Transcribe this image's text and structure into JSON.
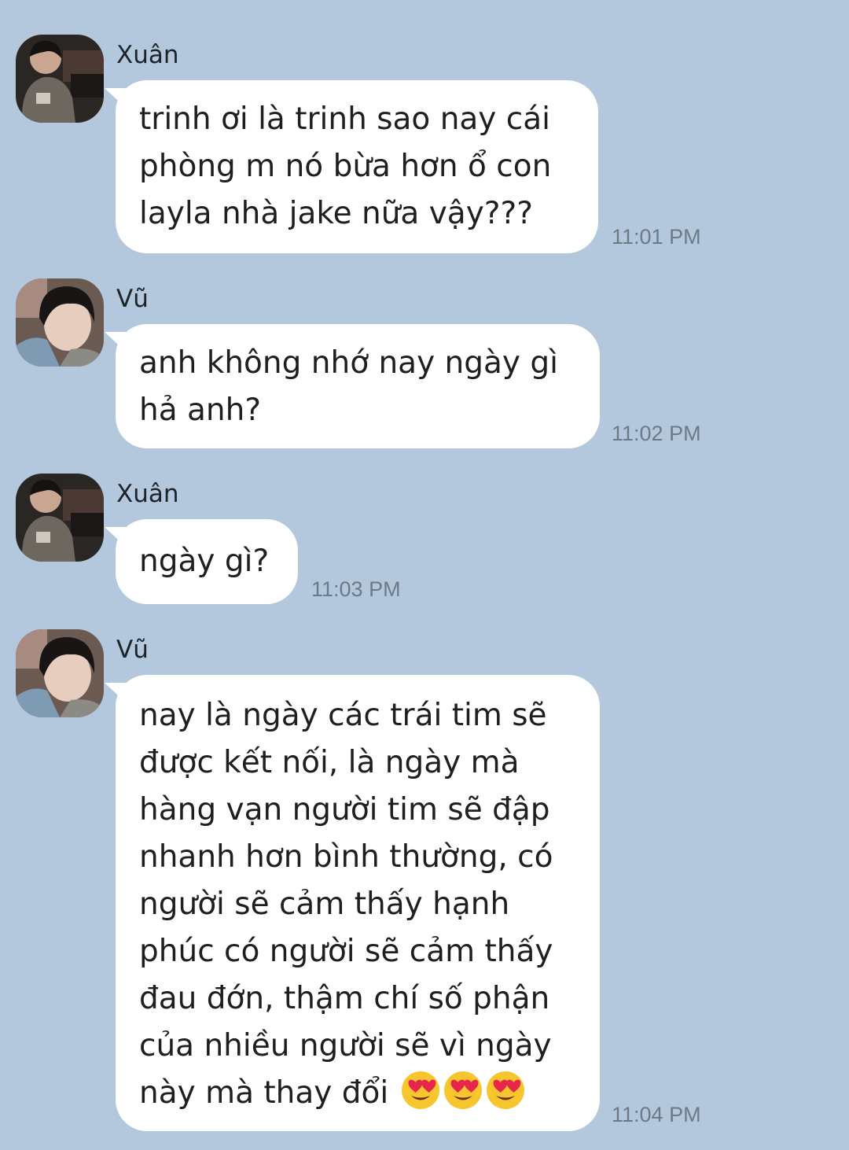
{
  "colors": {
    "background": "#b3c8dc",
    "bubble": "#ffffff",
    "text": "#1f1f1f",
    "time": "#6d7a86"
  },
  "messages": [
    {
      "sender": "Xuân",
      "avatar": "xuan-avatar",
      "lines": [
        "trinh ơi là trinh sao nay cái",
        "phòng m nó bừa hơn ổ con",
        "layla nhà jake nữa vậy???"
      ],
      "time": "11:01 PM"
    },
    {
      "sender": "Vũ",
      "avatar": "vu-avatar",
      "lines": [
        "anh không nhớ nay ngày gì",
        "hả anh?"
      ],
      "time": "11:02 PM"
    },
    {
      "sender": "Xuân",
      "avatar": "xuan-avatar",
      "lines": [
        "ngày gì?"
      ],
      "time": "11:03 PM"
    },
    {
      "sender": "Vũ",
      "avatar": "vu-avatar",
      "lines": [
        "nay là ngày các trái tim sẽ",
        "được kết nối, là ngày mà",
        "hàng vạn người tim sẽ đập",
        "nhanh hơn bình thường, có",
        "người sẽ cảm thấy hạnh",
        "phúc có người sẽ cảm thấy",
        "đau đớn, thậm chí số phận",
        "của nhiều người sẽ vì ngày",
        "này mà thay đổi"
      ],
      "emojis": [
        "heart-eyes-emoji",
        "heart-eyes-emoji",
        "heart-eyes-emoji"
      ],
      "time": "11:04 PM"
    }
  ]
}
